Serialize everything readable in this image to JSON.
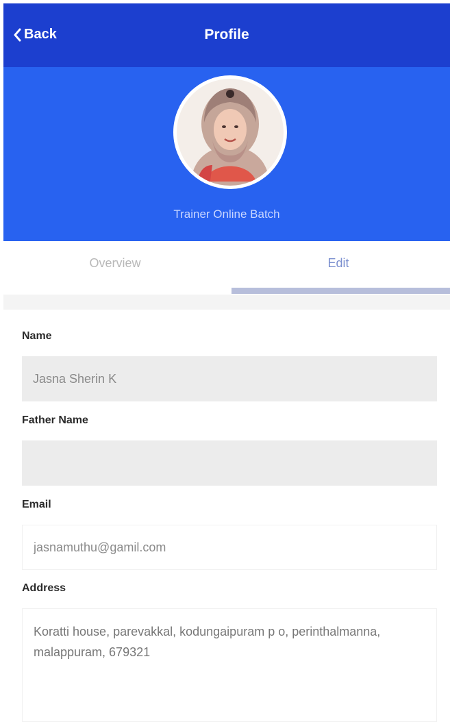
{
  "navbar": {
    "back_label": "Back",
    "title": "Profile",
    "bg_color": "#1c3fcf"
  },
  "header": {
    "subtitle": "Trainer Online Batch",
    "bg_color": "#2862f0"
  },
  "tabs": [
    {
      "label": "Overview",
      "active": false
    },
    {
      "label": "Edit",
      "active": true
    }
  ],
  "form": {
    "name": {
      "label": "Name",
      "value": "Jasna Sherin K"
    },
    "father_name": {
      "label": "Father Name",
      "value": ""
    },
    "email": {
      "label": "Email",
      "value": "jasnamuthu@gamil.com"
    },
    "address": {
      "label": "Address",
      "value": "Koratti house, parevakkal, kodungaipuram p o, perinthalmanna, malappuram, 679321"
    }
  }
}
